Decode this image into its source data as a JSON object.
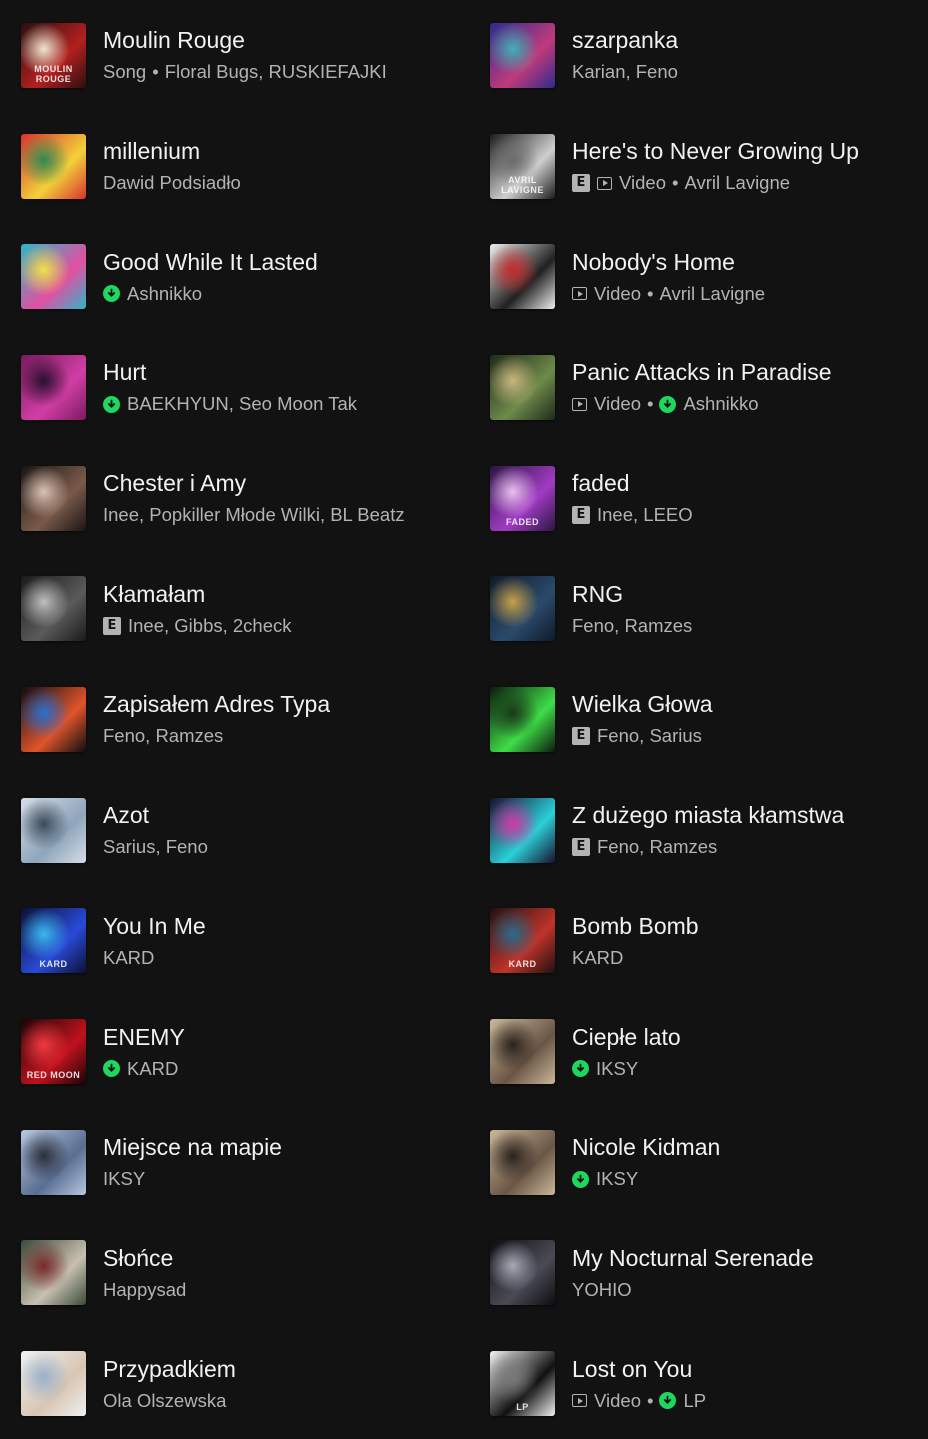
{
  "items": [
    {
      "title": "Moulin Rouge",
      "type": "Song",
      "artists": "Floral Bugs, RUSKIEFAJKI",
      "explicit": false,
      "downloaded": false,
      "video": false,
      "cover": "moulin-rouge-cover",
      "colors": [
        "#2a0f10",
        "#b3201f",
        "#f0e6d0"
      ],
      "cover_text": "MOULIN ROUGE"
    },
    {
      "title": "szarpanka",
      "type": "",
      "artists": "Karian, Feno",
      "explicit": false,
      "downloaded": false,
      "video": false,
      "cover": "szarpanka-cover",
      "colors": [
        "#2d2b8c",
        "#c03a7a",
        "#3fb0b8"
      ],
      "cover_text": ""
    },
    {
      "title": "millenium",
      "type": "",
      "artists": "Dawid Podsiadło",
      "explicit": false,
      "downloaded": false,
      "video": false,
      "cover": "millenium-cover",
      "colors": [
        "#d8322f",
        "#f2d13a",
        "#2f8a52"
      ],
      "cover_text": ""
    },
    {
      "title": "Here's to Never Growing Up",
      "type": "Video",
      "artists": "Avril Lavigne",
      "explicit": true,
      "downloaded": false,
      "video": true,
      "cover": "avril-never-growing-up-cover",
      "colors": [
        "#1b1b1b",
        "#cfcfcf",
        "#6b6b6b"
      ],
      "cover_text": "AVRIL LAVIGNE"
    },
    {
      "title": "Good While It Lasted",
      "type": "",
      "artists": "Ashnikko",
      "explicit": false,
      "downloaded": true,
      "video": false,
      "cover": "good-while-it-lasted-cover",
      "colors": [
        "#2fb6c8",
        "#e24fa0",
        "#f3e04a"
      ],
      "cover_text": ""
    },
    {
      "title": "Nobody's Home",
      "type": "Video",
      "artists": "Avril Lavigne",
      "explicit": false,
      "downloaded": false,
      "video": true,
      "cover": "nobodys-home-cover",
      "colors": [
        "#f0f0f0",
        "#202020",
        "#c62a2a"
      ],
      "cover_text": ""
    },
    {
      "title": "Hurt",
      "type": "",
      "artists": "BAEKHYUN, Seo Moon Tak",
      "explicit": false,
      "downloaded": true,
      "video": false,
      "cover": "hurt-cover",
      "colors": [
        "#7a1a5e",
        "#d23ea4",
        "#2b1030"
      ],
      "cover_text": ""
    },
    {
      "title": "Panic Attacks in Paradise",
      "type": "Video",
      "artists": "Ashnikko",
      "explicit": false,
      "downloaded": true,
      "video": true,
      "cover": "panic-attacks-cover",
      "colors": [
        "#1f2a1a",
        "#6e8a4a",
        "#c9b680"
      ],
      "cover_text": ""
    },
    {
      "title": "Chester i Amy",
      "type": "",
      "artists": "Inee, Popkiller Młode Wilki, BL Beatz",
      "explicit": false,
      "downloaded": false,
      "video": false,
      "cover": "chester-i-amy-cover",
      "colors": [
        "#1a1414",
        "#7a5a4a",
        "#d9c3b2"
      ],
      "cover_text": ""
    },
    {
      "title": "faded",
      "type": "",
      "artists": "Inee, LEEO",
      "explicit": true,
      "downloaded": false,
      "video": false,
      "cover": "faded-cover",
      "colors": [
        "#2a1640",
        "#a13bc4",
        "#e9c0ef"
      ],
      "cover_text": "FADED"
    },
    {
      "title": "Kłamałam",
      "type": "",
      "artists": "Inee, Gibbs, 2check",
      "explicit": true,
      "downloaded": false,
      "video": false,
      "cover": "klamalam-cover",
      "colors": [
        "#1a1a1a",
        "#5a5a5a",
        "#bfbfbf"
      ],
      "cover_text": ""
    },
    {
      "title": "RNG",
      "type": "",
      "artists": "Feno, Ramzes",
      "explicit": false,
      "downloaded": false,
      "video": false,
      "cover": "rng-cover",
      "colors": [
        "#0f1a2a",
        "#2b4a6b",
        "#c7a14a"
      ],
      "cover_text": ""
    },
    {
      "title": "Zapisałem Adres Typa",
      "type": "",
      "artists": "Feno, Ramzes",
      "explicit": false,
      "downloaded": false,
      "video": false,
      "cover": "zapisalem-adres-typa-cover",
      "colors": [
        "#0d0d12",
        "#e0542a",
        "#2a6fd0"
      ],
      "cover_text": ""
    },
    {
      "title": "Wielka Głowa",
      "type": "",
      "artists": "Feno, Sarius",
      "explicit": true,
      "downloaded": false,
      "video": false,
      "cover": "wielka-glowa-cover",
      "colors": [
        "#0c1a0c",
        "#3fdc48",
        "#1a3a1a"
      ],
      "cover_text": ""
    },
    {
      "title": "Azot",
      "type": "",
      "artists": "Sarius, Feno",
      "explicit": false,
      "downloaded": false,
      "video": false,
      "cover": "azot-cover",
      "colors": [
        "#d6dde6",
        "#8fa5bc",
        "#3a4a5a"
      ],
      "cover_text": ""
    },
    {
      "title": "Z dużego miasta kłamstwa",
      "type": "",
      "artists": "Feno, Ramzes",
      "explicit": true,
      "downloaded": false,
      "video": false,
      "cover": "z-duzego-miasta-cover",
      "colors": [
        "#1a0f2e",
        "#2ad0d8",
        "#d03aa8"
      ],
      "cover_text": ""
    },
    {
      "title": "You In Me",
      "type": "",
      "artists": "KARD",
      "explicit": false,
      "downloaded": false,
      "video": false,
      "cover": "you-in-me-cover",
      "colors": [
        "#0b1030",
        "#2a4ad8",
        "#3ab8f0"
      ],
      "cover_text": "KARD"
    },
    {
      "title": "Bomb Bomb",
      "type": "",
      "artists": "KARD",
      "explicit": false,
      "downloaded": false,
      "video": false,
      "cover": "bomb-bomb-cover",
      "colors": [
        "#201010",
        "#c0342a",
        "#2a6a8a"
      ],
      "cover_text": "KARD"
    },
    {
      "title": "ENEMY",
      "type": "",
      "artists": "KARD",
      "explicit": false,
      "downloaded": true,
      "video": false,
      "cover": "enemy-cover",
      "colors": [
        "#1a0405",
        "#c0121e",
        "#f03a40"
      ],
      "cover_text": "RED MOON"
    },
    {
      "title": "Ciepłe lato",
      "type": "",
      "artists": "IKSY",
      "explicit": false,
      "downloaded": true,
      "video": false,
      "cover": "cieple-lato-cover",
      "colors": [
        "#c9b89a",
        "#6a5646",
        "#2a221c"
      ],
      "cover_text": ""
    },
    {
      "title": "Miejsce na mapie",
      "type": "",
      "artists": "IKSY",
      "explicit": false,
      "downloaded": false,
      "video": false,
      "cover": "miejsce-na-mapie-cover",
      "colors": [
        "#b9c7e0",
        "#5a6e92",
        "#2a2e3a"
      ],
      "cover_text": ""
    },
    {
      "title": "Nicole Kidman",
      "type": "",
      "artists": "IKSY",
      "explicit": false,
      "downloaded": true,
      "video": false,
      "cover": "nicole-kidman-cover",
      "colors": [
        "#c9b89a",
        "#6a5646",
        "#2a221c"
      ],
      "cover_text": ""
    },
    {
      "title": "Słońce",
      "type": "",
      "artists": "Happysad",
      "explicit": false,
      "downloaded": false,
      "video": false,
      "cover": "slonce-cover",
      "colors": [
        "#3a4a3a",
        "#c8c0b0",
        "#7a2a2a"
      ],
      "cover_text": ""
    },
    {
      "title": "My Nocturnal Serenade",
      "type": "",
      "artists": "YOHIO",
      "explicit": false,
      "downloaded": false,
      "video": false,
      "cover": "my-nocturnal-serenade-cover",
      "colors": [
        "#0d0d10",
        "#4a4a56",
        "#a8a8b8"
      ],
      "cover_text": ""
    },
    {
      "title": "Przypadkiem",
      "type": "",
      "artists": "Ola Olszewska",
      "explicit": false,
      "downloaded": false,
      "video": false,
      "cover": "przypadkiem-cover",
      "colors": [
        "#eef0f2",
        "#d8c6b2",
        "#9ab0c8"
      ],
      "cover_text": ""
    },
    {
      "title": "Lost on You",
      "type": "Video",
      "artists": "LP",
      "explicit": false,
      "downloaded": true,
      "video": true,
      "cover": "lost-on-you-cover",
      "colors": [
        "#f2f2f2",
        "#111111",
        "#7a7a7a"
      ],
      "cover_text": "LP"
    }
  ]
}
